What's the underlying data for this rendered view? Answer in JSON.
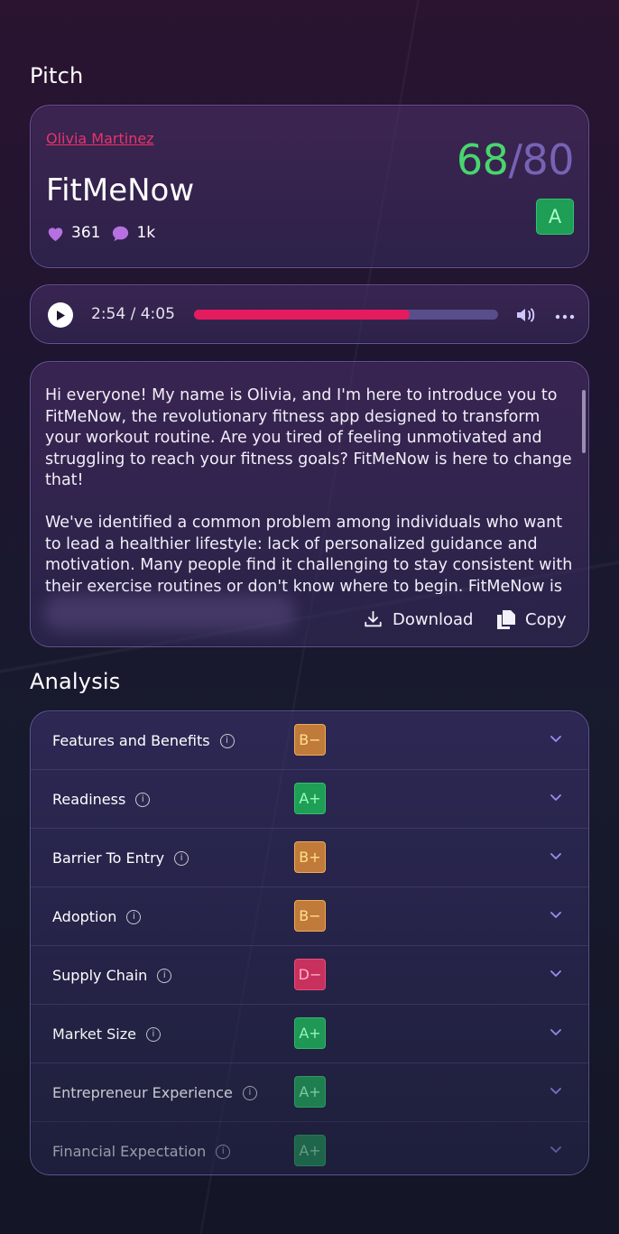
{
  "pitch_section": {
    "title": "Pitch"
  },
  "pitch": {
    "author": "Olivia Martinez",
    "name": "FitMeNow",
    "likes": "361",
    "comments": "1k",
    "score": "68",
    "score_separator": "/",
    "score_total": "80",
    "grade": "A"
  },
  "player": {
    "time": "2:54 / 4:05",
    "progress_fraction": 0.71,
    "icons": {
      "play": "play-icon",
      "volume": "volume-icon",
      "more": "more-icon"
    }
  },
  "transcript": {
    "paragraphs": [
      "Hi everyone! My name is Olivia, and I'm here to introduce you to FitMeNow, the revolutionary fitness app designed to transform your workout routine. Are you tired of feeling unmotivated and struggling to reach your fitness goals? FitMeNow is here to change that!",
      "We've identified a common problem among individuals who want to lead a healthier lifestyle: lack of personalized guidance and motivation. Many people find it challenging to stay consistent with their exercise routines or don't know where to begin. FitMeNow is"
    ],
    "download_label": "Download",
    "copy_label": "Copy"
  },
  "analysis_section": {
    "title": "Analysis"
  },
  "analysis": {
    "rows": [
      {
        "label": "Features and Benefits",
        "grade": "B−",
        "color": "#c07a3a"
      },
      {
        "label": "Readiness",
        "grade": "A+",
        "color": "#1f9e56"
      },
      {
        "label": "Barrier To Entry",
        "grade": "B+",
        "color": "#c07a3a"
      },
      {
        "label": "Adoption",
        "grade": "B−",
        "color": "#c07a3a"
      },
      {
        "label": "Supply Chain",
        "grade": "D−",
        "color": "#c8305e"
      },
      {
        "label": "Market Size",
        "grade": "A+",
        "color": "#1f9e56"
      },
      {
        "label": "Entrepreneur Experience",
        "grade": "A+",
        "color": "#1f9e56"
      },
      {
        "label": "Financial Expectation",
        "grade": "A+",
        "color": "#1f9e56"
      }
    ]
  },
  "colors": {
    "accent_pink": "#e51b5f",
    "score_green": "#49d56e",
    "score_purple": "#7763b4"
  }
}
